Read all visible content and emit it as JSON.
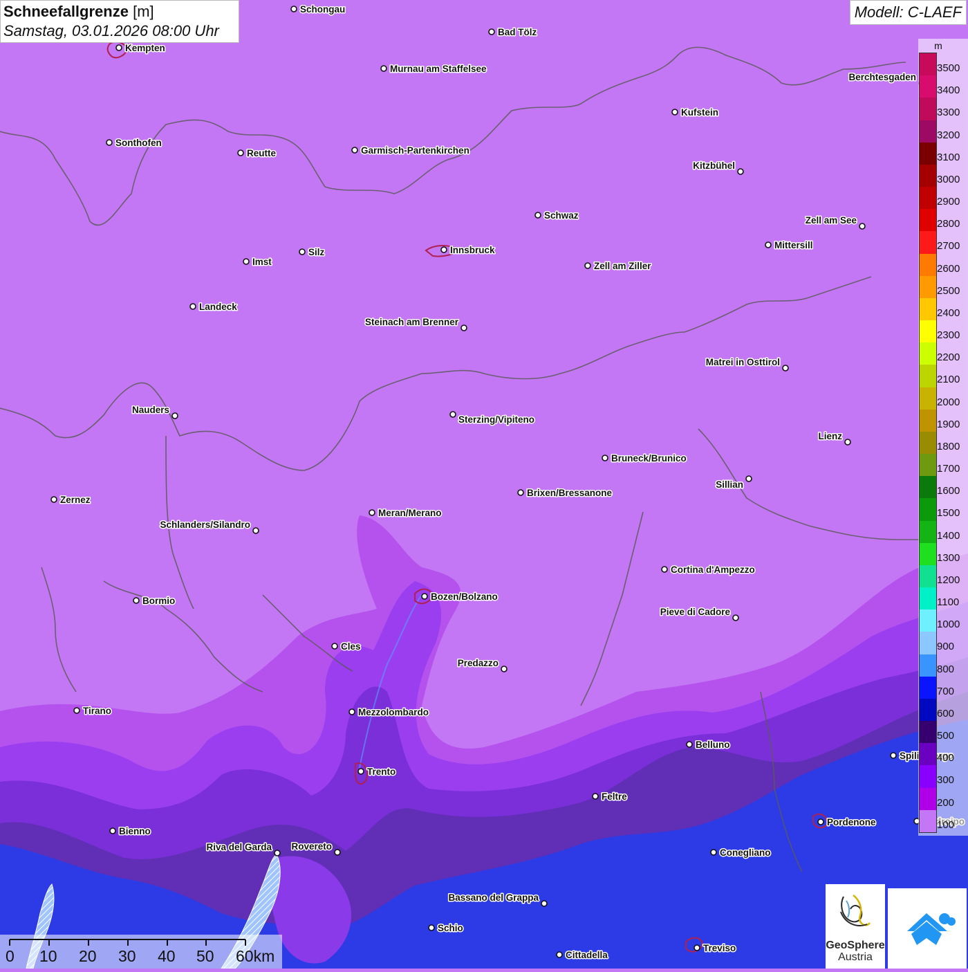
{
  "title": {
    "main": "Schneefallgrenze",
    "unit": "[m]",
    "datetime": "Samstag, 03.01.2026 08:00 Uhr"
  },
  "model": "Modell: C-LAEF",
  "legend": {
    "unit": "m",
    "items": [
      {
        "label": "3500",
        "color": "#c80a5a"
      },
      {
        "label": "3400",
        "color": "#d80c6c"
      },
      {
        "label": "3300",
        "color": "#c00a5a"
      },
      {
        "label": "3200",
        "color": "#9c0a64"
      },
      {
        "label": "3100",
        "color": "#7a0000"
      },
      {
        "label": "3000",
        "color": "#a40000"
      },
      {
        "label": "2900",
        "color": "#c00000"
      },
      {
        "label": "2800",
        "color": "#e00000"
      },
      {
        "label": "2700",
        "color": "#ff1a1a"
      },
      {
        "label": "2600",
        "color": "#ff7a00"
      },
      {
        "label": "2500",
        "color": "#ff9a00"
      },
      {
        "label": "2400",
        "color": "#ffc800"
      },
      {
        "label": "2300",
        "color": "#ffff00"
      },
      {
        "label": "2200",
        "color": "#ccff00"
      },
      {
        "label": "2100",
        "color": "#bcd400"
      },
      {
        "label": "2000",
        "color": "#c8b400"
      },
      {
        "label": "1900",
        "color": "#c09400"
      },
      {
        "label": "1800",
        "color": "#9a8c00"
      },
      {
        "label": "1700",
        "color": "#6e9a10"
      },
      {
        "label": "1600",
        "color": "#0a7a0a"
      },
      {
        "label": "1500",
        "color": "#0a9a0a"
      },
      {
        "label": "1400",
        "color": "#14b414"
      },
      {
        "label": "1300",
        "color": "#1ee01e"
      },
      {
        "label": "1200",
        "color": "#10e090"
      },
      {
        "label": "1100",
        "color": "#00f0c8"
      },
      {
        "label": "1000",
        "color": "#6ef0ff"
      },
      {
        "label": "900",
        "color": "#8cc8ff"
      },
      {
        "label": "800",
        "color": "#3a94ff"
      },
      {
        "label": "700",
        "color": "#0a14ff"
      },
      {
        "label": "600",
        "color": "#0008c0"
      },
      {
        "label": "500",
        "color": "#36006e"
      },
      {
        "label": "400",
        "color": "#6a00c0"
      },
      {
        "label": "300",
        "color": "#8a00ff"
      },
      {
        "label": "200",
        "color": "#b000e8"
      },
      {
        "label": "100",
        "color": "#c477f4"
      }
    ]
  },
  "cities": [
    {
      "name": "Schongau"
    },
    {
      "name": "Kempten"
    },
    {
      "name": "Bad Tölz"
    },
    {
      "name": "Murnau am Staffelsee"
    },
    {
      "name": "Berchtesgaden"
    },
    {
      "name": "Kufstein"
    },
    {
      "name": "Sonthofen"
    },
    {
      "name": "Reutte"
    },
    {
      "name": "Garmisch-Partenkirchen"
    },
    {
      "name": "Kitzbühel"
    },
    {
      "name": "Schwaz"
    },
    {
      "name": "Zell am See"
    },
    {
      "name": "Mittersill"
    },
    {
      "name": "Innsbruck"
    },
    {
      "name": "Silz"
    },
    {
      "name": "Imst"
    },
    {
      "name": "Zell am Ziller"
    },
    {
      "name": "Landeck"
    },
    {
      "name": "Steinach am Brenner"
    },
    {
      "name": "Matrei in Osttirol"
    },
    {
      "name": "Nauders"
    },
    {
      "name": "Sterzing/Vipiteno"
    },
    {
      "name": "Lienz"
    },
    {
      "name": "Bruneck/Brunico"
    },
    {
      "name": "Sillian"
    },
    {
      "name": "Zernez"
    },
    {
      "name": "Brixen/Bressanone"
    },
    {
      "name": "Meran/Merano"
    },
    {
      "name": "Schlanders/Silandro"
    },
    {
      "name": "Cortina d'Ampezzo"
    },
    {
      "name": "Bormio"
    },
    {
      "name": "Bozen/Bolzano"
    },
    {
      "name": "Pieve di Cadore"
    },
    {
      "name": "Cles"
    },
    {
      "name": "Predazzo"
    },
    {
      "name": "Tirano"
    },
    {
      "name": "Mezzolombardo"
    },
    {
      "name": "Belluno"
    },
    {
      "name": "Spilimbergo"
    },
    {
      "name": "Trento"
    },
    {
      "name": "Feltre"
    },
    {
      "name": "Pordenone"
    },
    {
      "name": "Codroipo"
    },
    {
      "name": "Bienno"
    },
    {
      "name": "Riva del Garda"
    },
    {
      "name": "Rovereto"
    },
    {
      "name": "Conegliano"
    },
    {
      "name": "Bassano del Grappa"
    },
    {
      "name": "Schio"
    },
    {
      "name": "Treviso"
    },
    {
      "name": "Cittadella"
    }
  ],
  "scale": {
    "labels": [
      "0",
      "10",
      "20",
      "30",
      "40",
      "50",
      "60km"
    ]
  },
  "logos": {
    "geosphere_line1": "GeoSphere",
    "geosphere_line2": "Austria"
  }
}
